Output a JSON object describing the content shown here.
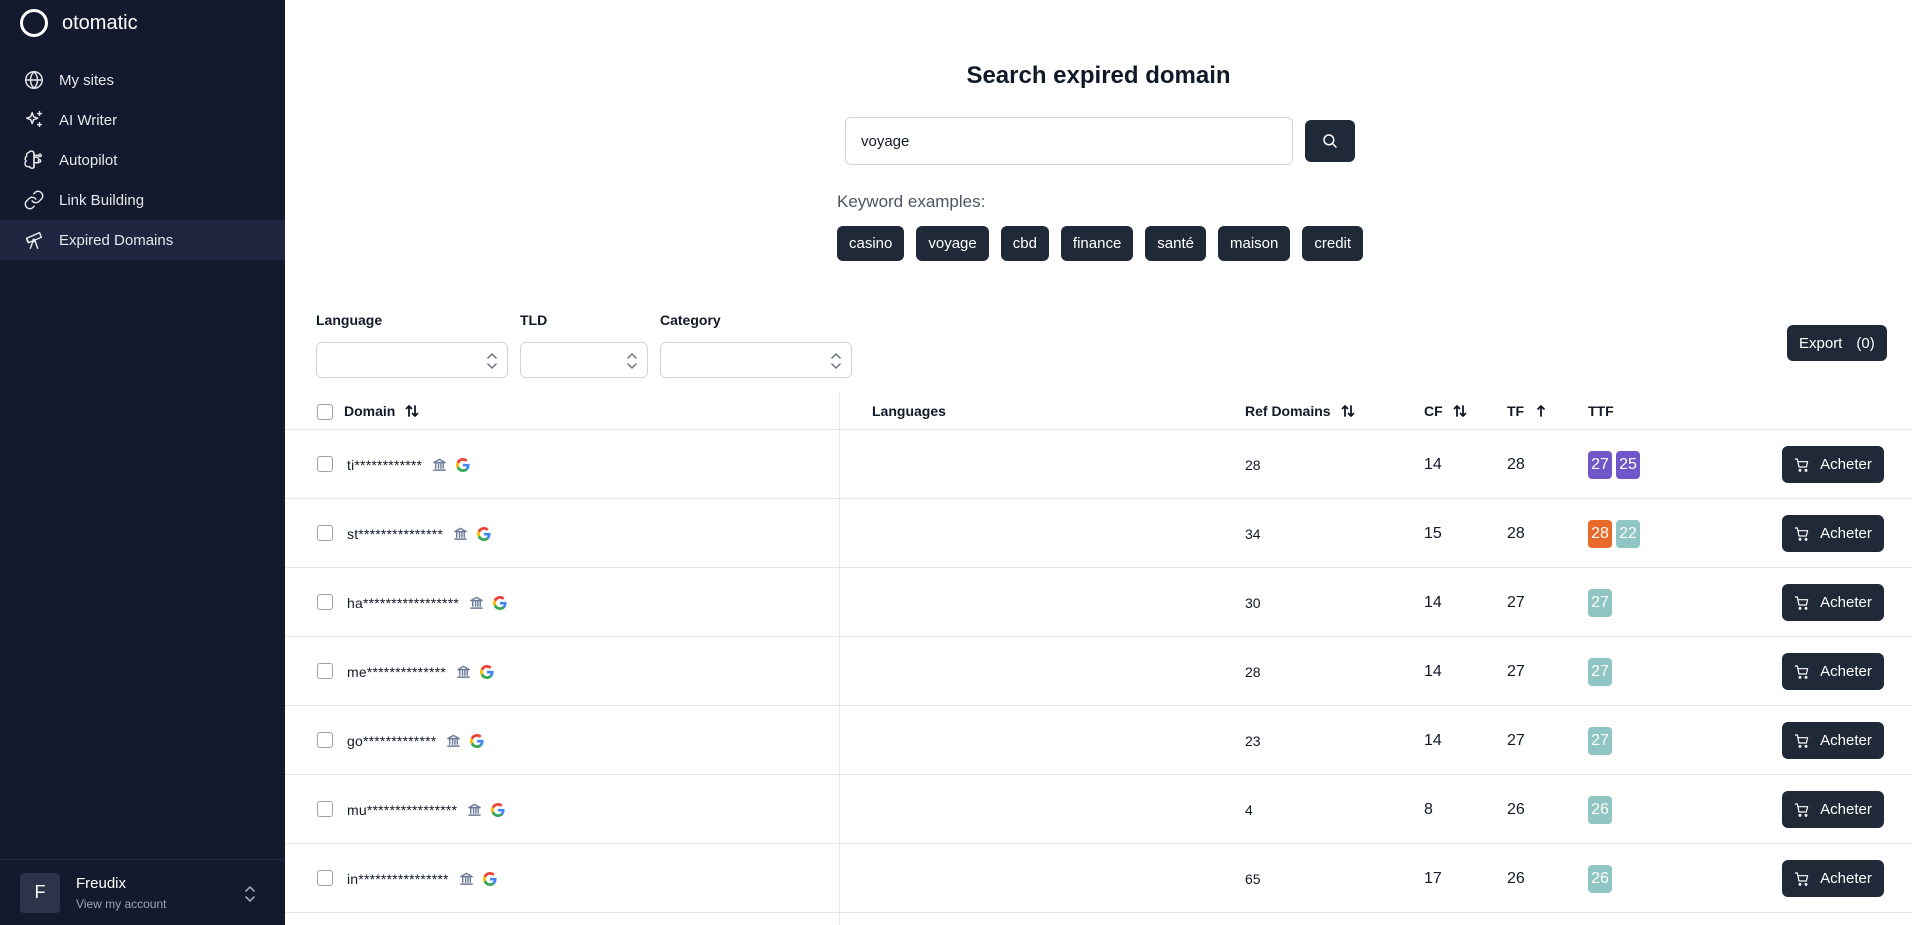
{
  "app": {
    "name": "otomatic"
  },
  "sidebar": {
    "items": [
      {
        "label": "My sites",
        "icon": "globe-icon"
      },
      {
        "label": "AI Writer",
        "icon": "sparkles-icon"
      },
      {
        "label": "Autopilot",
        "icon": "brain-icon"
      },
      {
        "label": "Link Building",
        "icon": "link-icon"
      },
      {
        "label": "Expired Domains",
        "icon": "telescope-icon",
        "active": true
      }
    ],
    "account": {
      "initial": "F",
      "name": "Freudix",
      "subtitle": "View my account"
    }
  },
  "main": {
    "title": "Search expired domain",
    "search": {
      "value": "voyage",
      "placeholder": ""
    },
    "keyword_label": "Keyword examples:",
    "keywords": [
      "casino",
      "voyage",
      "cbd",
      "finance",
      "santé",
      "maison",
      "credit"
    ],
    "filters": {
      "language": {
        "label": "Language",
        "value": ""
      },
      "tld": {
        "label": "TLD",
        "value": ""
      },
      "category": {
        "label": "Category",
        "value": ""
      }
    },
    "export": {
      "label": "Export",
      "count": "(0)"
    }
  },
  "table": {
    "headers": {
      "domain": "Domain",
      "languages": "Languages",
      "ref_domains": "Ref Domains",
      "cf": "CF",
      "tf": "TF",
      "ttf": "TTF"
    },
    "buy_label": "Acheter",
    "colors": {
      "purple": "#7156c9",
      "orange": "#ea6a2b",
      "teal": "#8fc5c2"
    },
    "rows": [
      {
        "domain": "ti************",
        "ref_domains": "28",
        "cf": "14",
        "tf": "28",
        "ttf": [
          {
            "value": "27",
            "color": "#7156c9"
          },
          {
            "value": "25",
            "color": "#7156c9"
          }
        ]
      },
      {
        "domain": "st***************",
        "ref_domains": "34",
        "cf": "15",
        "tf": "28",
        "ttf": [
          {
            "value": "28",
            "color": "#ea6a2b"
          },
          {
            "value": "22",
            "color": "#8fc5c2"
          }
        ]
      },
      {
        "domain": "ha*****************",
        "ref_domains": "30",
        "cf": "14",
        "tf": "27",
        "ttf": [
          {
            "value": "27",
            "color": "#8fc5c2"
          }
        ]
      },
      {
        "domain": "me**************",
        "ref_domains": "28",
        "cf": "14",
        "tf": "27",
        "ttf": [
          {
            "value": "27",
            "color": "#8fc5c2"
          }
        ]
      },
      {
        "domain": "go*************",
        "ref_domains": "23",
        "cf": "14",
        "tf": "27",
        "ttf": [
          {
            "value": "27",
            "color": "#8fc5c2"
          }
        ]
      },
      {
        "domain": "mu****************",
        "ref_domains": "4",
        "cf": "8",
        "tf": "26",
        "ttf": [
          {
            "value": "26",
            "color": "#8fc5c2"
          }
        ]
      },
      {
        "domain": "in****************",
        "ref_domains": "65",
        "cf": "17",
        "tf": "26",
        "ttf": [
          {
            "value": "26",
            "color": "#8fc5c2"
          }
        ]
      }
    ]
  }
}
